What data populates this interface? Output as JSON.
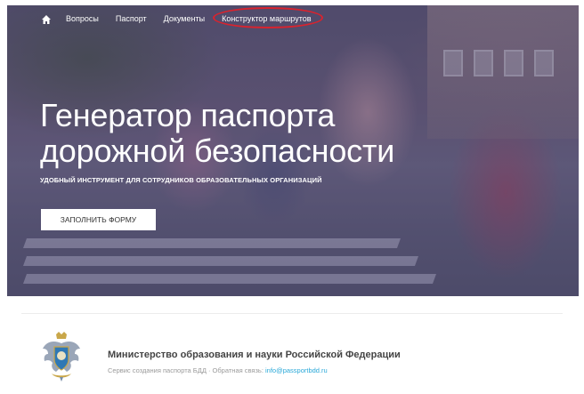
{
  "nav": {
    "items": [
      {
        "label": "Вопросы"
      },
      {
        "label": "Паспорт"
      },
      {
        "label": "Документы"
      },
      {
        "label": "Конструктор маршрутов"
      }
    ]
  },
  "hero": {
    "title_line1": "Генератор паспорта",
    "title_line2": "дорожной безопасности",
    "subtitle": "УДОБНЫЙ ИНСТРУМЕНТ ДЛЯ СОТРУДНИКОВ ОБРАЗОВАТЕЛЬНЫХ ОРГАНИЗАЦИЙ",
    "cta_label": "ЗАПОЛНИТЬ ФОРМУ"
  },
  "footer": {
    "ministry": "Министерство образования и науки Российской Федерации",
    "info_prefix": "Сервис создания паспорта БДД · Обратная связь: ",
    "email": "info@passportbdd.ru"
  },
  "colors": {
    "highlight": "#d9232e",
    "link": "#29a8d8",
    "text_dark": "#444444",
    "text_muted": "#9a9a9a"
  },
  "icons": {
    "home": "home-icon",
    "emblem": "emblem-icon"
  }
}
